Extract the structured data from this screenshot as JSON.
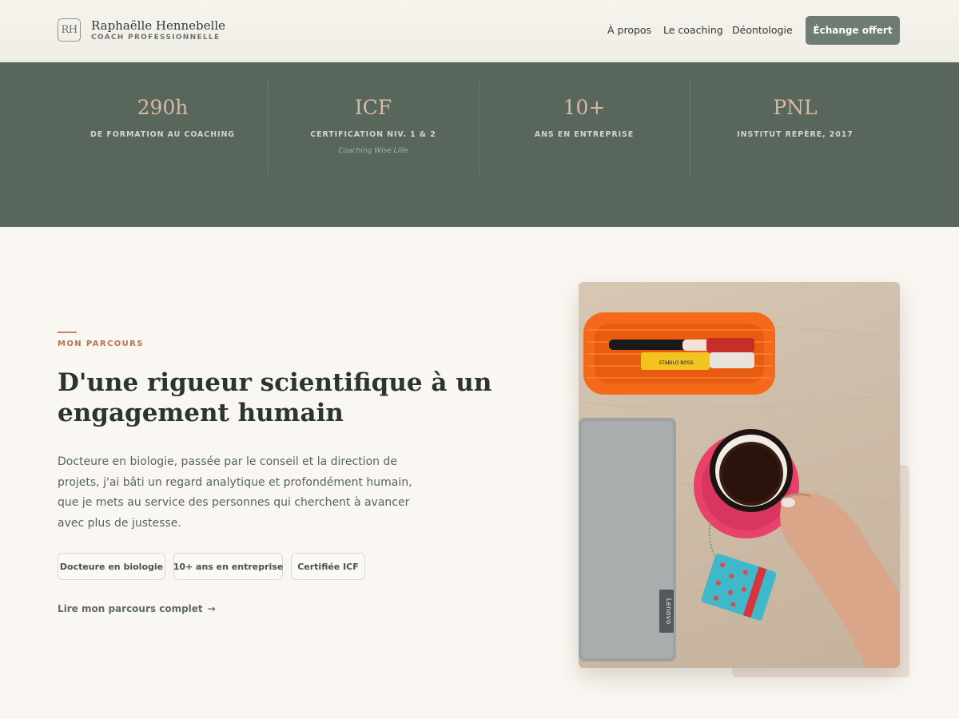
{
  "header": {
    "logo_initials": "RH",
    "brand_name": "Raphaëlle Hennebelle",
    "brand_tagline": "COACH PROFESSIONNELLE",
    "nav": [
      "À propos",
      "Le coaching",
      "Déontologie"
    ],
    "cta_label": "Échange offert"
  },
  "stats": [
    {
      "value": "290h",
      "label": "DE FORMATION AU COACHING",
      "note": ""
    },
    {
      "value": "ICF",
      "label": "CERTIFICATION NIV. 1 & 2",
      "note": "Coaching Wise Lille"
    },
    {
      "value": "10+",
      "label": "ANS EN ENTREPRISE",
      "note": ""
    },
    {
      "value": "PNL",
      "label": "INSTITUT REPÈRE, 2017",
      "note": ""
    }
  ],
  "about": {
    "eyebrow": "MON PARCOURS",
    "headline": "D'une rigueur scientifique à un engagement humain",
    "lead": "Docteure en biologie, passée par le conseil et la direction de projets, j'ai bâti un regard analytique et profondément humain, que je mets au service des personnes qui cherchent à avancer avec plus de justesse.",
    "tags": [
      "Docteure en biologie",
      "10+ ans en entreprise",
      "Certifiée ICF"
    ],
    "link_label": "Lire mon parcours complet",
    "link_arrow": "→"
  },
  "photo": {
    "laptop_brand": "Lenovo",
    "marker_label": "STABILO BOSS"
  },
  "colors": {
    "accent_green": "#58665c",
    "button_green": "#6e7c73",
    "terracotta": "#c4815b",
    "stat_value": "#d8b9a2",
    "background": "#faf7f2"
  }
}
